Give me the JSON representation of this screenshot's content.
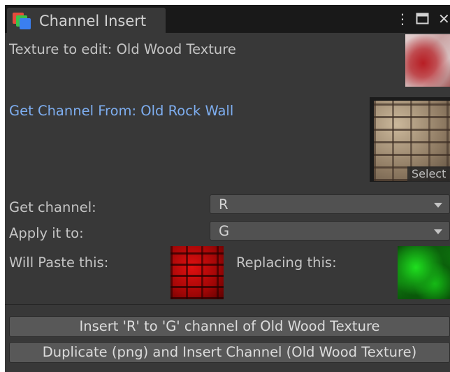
{
  "window": {
    "tab_title": "Channel Insert",
    "menu_icon": "kebab-menu-icon",
    "maximize_icon": "maximize-icon",
    "close_icon": "close-icon"
  },
  "texture_to_edit": {
    "label": "Texture to edit: Old Wood Texture"
  },
  "channel_source": {
    "label": "Get Channel From: Old Rock Wall",
    "select_label": "Select"
  },
  "get_channel": {
    "label": "Get channel:",
    "value": "R"
  },
  "apply_to": {
    "label": "Apply it to:",
    "value": "G"
  },
  "preview": {
    "will_paste_label": "Will Paste this:",
    "replacing_label": "Replacing this:"
  },
  "buttons": {
    "insert": "Insert 'R' to 'G' channel of Old Wood Texture",
    "duplicate": "Duplicate (png) and Insert Channel (Old Wood Texture)"
  },
  "colors": {
    "link": "#7eaef0",
    "panel": "#383838",
    "tabbar": "#191919",
    "dropdown": "#515151"
  }
}
